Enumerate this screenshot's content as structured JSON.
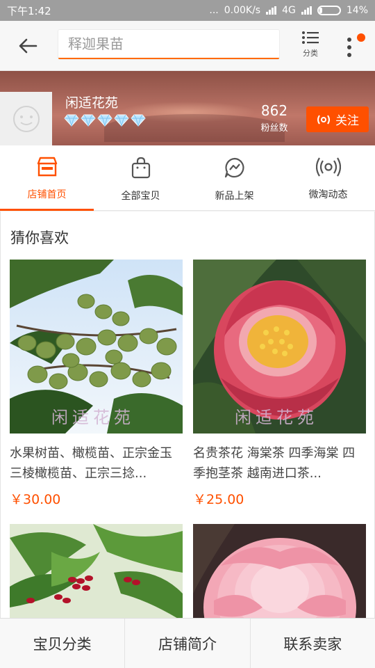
{
  "status_bar": {
    "time": "下午1:42",
    "dots": "...",
    "speed": "0.00K/s",
    "network": "4G",
    "battery": "14%",
    "battery_level": 0.14
  },
  "header": {
    "search_placeholder": "释迦果苗",
    "category_label": "分类",
    "back_icon": "back-arrow-icon",
    "more_icon": "more-vertical-icon"
  },
  "shop": {
    "name": "闲适花苑",
    "diamond_count": 5,
    "fans_count": "862",
    "fans_label": "粉丝数",
    "follow_label": "关注"
  },
  "tabs": [
    {
      "label": "店铺首页",
      "icon": "store-icon",
      "active": true
    },
    {
      "label": "全部宝贝",
      "icon": "shopping-bag-icon",
      "active": false
    },
    {
      "label": "新品上架",
      "icon": "new-arrival-chat-icon",
      "active": false
    },
    {
      "label": "微淘动态",
      "icon": "broadcast-icon",
      "active": false
    }
  ],
  "recommend": {
    "title": "猜你喜欢",
    "products": [
      {
        "title": "水果树苗、橄榄苗、正宗金玉三棱橄榄苗、正宗三捻...",
        "price": "￥30.00",
        "watermark": "闲适花苑"
      },
      {
        "title": "名贵茶花 海棠茶 四季海棠 四季抱茎茶 越南进口茶...",
        "price": "￥25.00",
        "watermark": "闲适花苑"
      },
      {
        "title": "",
        "price": "",
        "watermark": ""
      },
      {
        "title": "",
        "price": "",
        "watermark": ""
      }
    ]
  },
  "bottom_nav": {
    "categories": "宝贝分类",
    "intro": "店铺简介",
    "contact": "联系卖家"
  },
  "colors": {
    "accent": "#ff5000",
    "status_bar": "#9e9e9e"
  }
}
